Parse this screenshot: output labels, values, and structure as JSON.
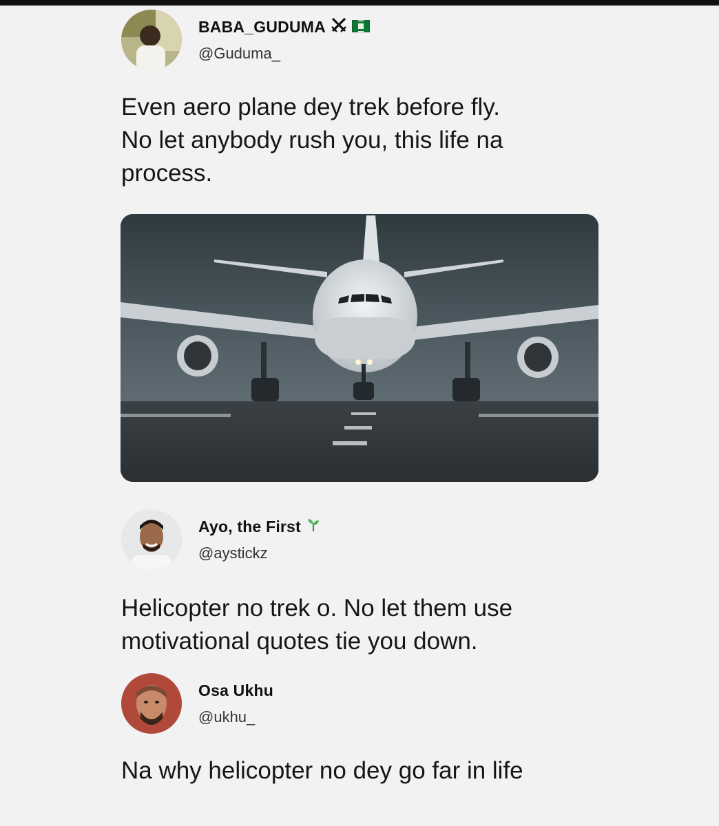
{
  "tweets": [
    {
      "display_name": "BABA_GUDUMA",
      "badges": [
        "crossed-swords-icon",
        "nigeria-flag-icon"
      ],
      "handle": "@Guduma_",
      "text": "Even aero plane dey trek before fly.\nNo let anybody rush you, this life na\nprocess.",
      "media": "airplane-on-runway-photo"
    },
    {
      "display_name": "Ayo, the First",
      "badges": [
        "seedling-icon"
      ],
      "handle": "@aystickz",
      "text": "Helicopter no trek o. No let them use\nmotivational quotes tie you down."
    },
    {
      "display_name": "Osa Ukhu",
      "badges": [],
      "handle": "@ukhu_",
      "text": "Na why helicopter no dey go far in life"
    }
  ],
  "colors": {
    "background": "#f2f2f2",
    "text": "#111111",
    "handle": "#333333",
    "media_sky": "#3d474c"
  }
}
